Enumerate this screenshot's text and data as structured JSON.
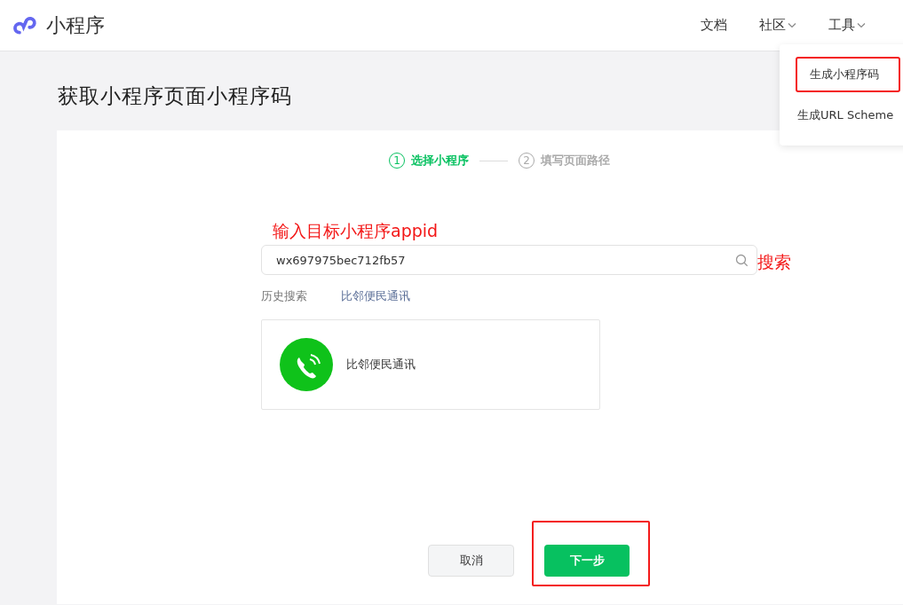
{
  "header": {
    "logo_text": "小程序",
    "nav": [
      {
        "label": "文档",
        "has_menu": false
      },
      {
        "label": "社区",
        "has_menu": true
      },
      {
        "label": "工具",
        "has_menu": true
      }
    ]
  },
  "dropdown": {
    "items": [
      {
        "label": "生成小程序码",
        "highlighted": true
      },
      {
        "label": "生成URL Scheme",
        "highlighted": false
      }
    ]
  },
  "page_title": "获取小程序页面小程序码",
  "steps": [
    {
      "number": "1",
      "label": "选择小程序",
      "active": true
    },
    {
      "number": "2",
      "label": "填写页面路径",
      "active": false
    }
  ],
  "search": {
    "value": "wx697975bec712fb57"
  },
  "history": {
    "label": "历史搜索",
    "items": [
      "比邻便民通讯"
    ]
  },
  "results": [
    {
      "name": "比邻便民通讯"
    }
  ],
  "buttons": [
    {
      "label": "取消",
      "kind": "secondary",
      "highlighted": false
    },
    {
      "label": "下一步",
      "kind": "primary",
      "highlighted": true
    }
  ],
  "annotations": [
    {
      "text": "输入目标小程序appid",
      "kind": "field-hint"
    },
    {
      "text": "搜索",
      "kind": "button-hint"
    }
  ]
}
